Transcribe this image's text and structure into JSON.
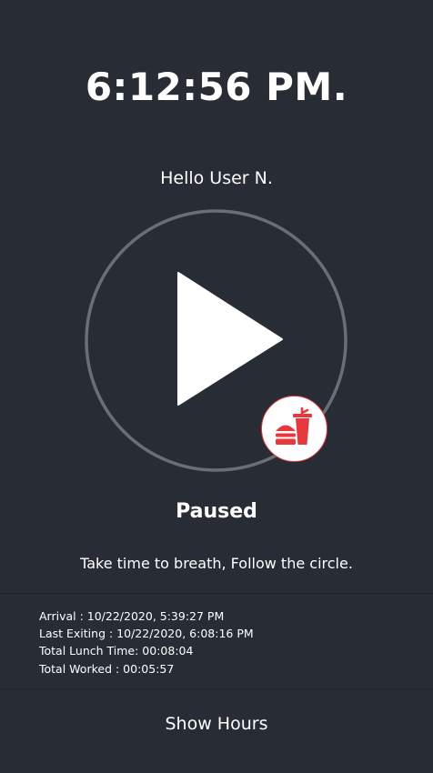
{
  "clock": "6:12:56 PM.",
  "greeting": "Hello User N.",
  "timer": {
    "control_icon": "play-icon",
    "lunch_icon": "burger-drink-icon"
  },
  "status": "Paused",
  "hint": "Take time to breath, Follow the circle.",
  "info": {
    "arrival": "Arrival : 10/22/2020, 5:39:27 PM",
    "last_exiting": "Last Exiting : 10/22/2020, 6:08:16 PM",
    "total_lunch": "Total Lunch Time: 00:08:04",
    "total_worked": "Total Worked : 00:05:57"
  },
  "show_hours_label": "Show Hours",
  "colors": {
    "background": "#282c35",
    "circle_ring": "#6c6e75",
    "lunch_accent": "#e5393f",
    "text": "#ffffff"
  }
}
